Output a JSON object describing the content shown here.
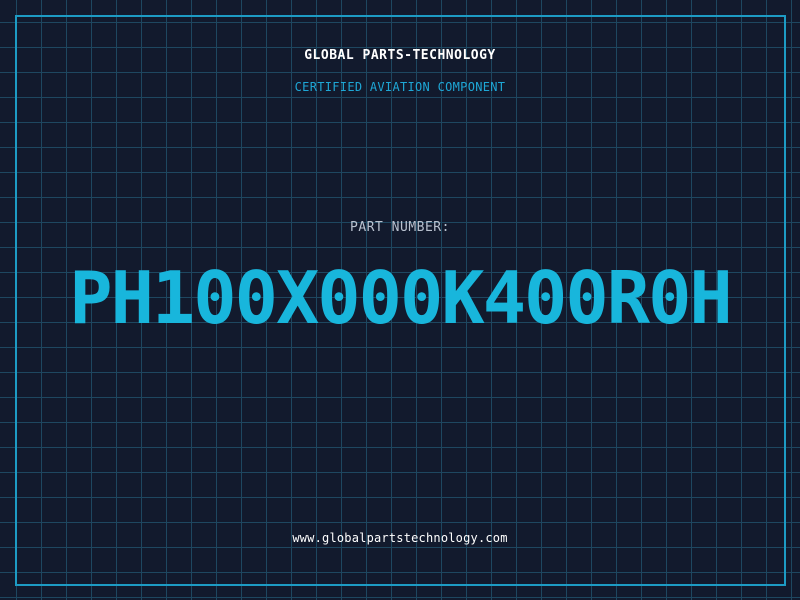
{
  "header": {
    "brand": "GLOBAL PARTS-TECHNOLOGY",
    "tagline": "CERTIFIED AVIATION COMPONENT"
  },
  "part": {
    "label": "PART NUMBER:",
    "number": "PH100X000K400R0H"
  },
  "footer": {
    "website": "www.globalpartstechnology.com"
  },
  "colors": {
    "background": "#121a2d",
    "grid": "#1f4a63",
    "accent": "#1ea7d6",
    "part_number": "#18b6dc"
  }
}
